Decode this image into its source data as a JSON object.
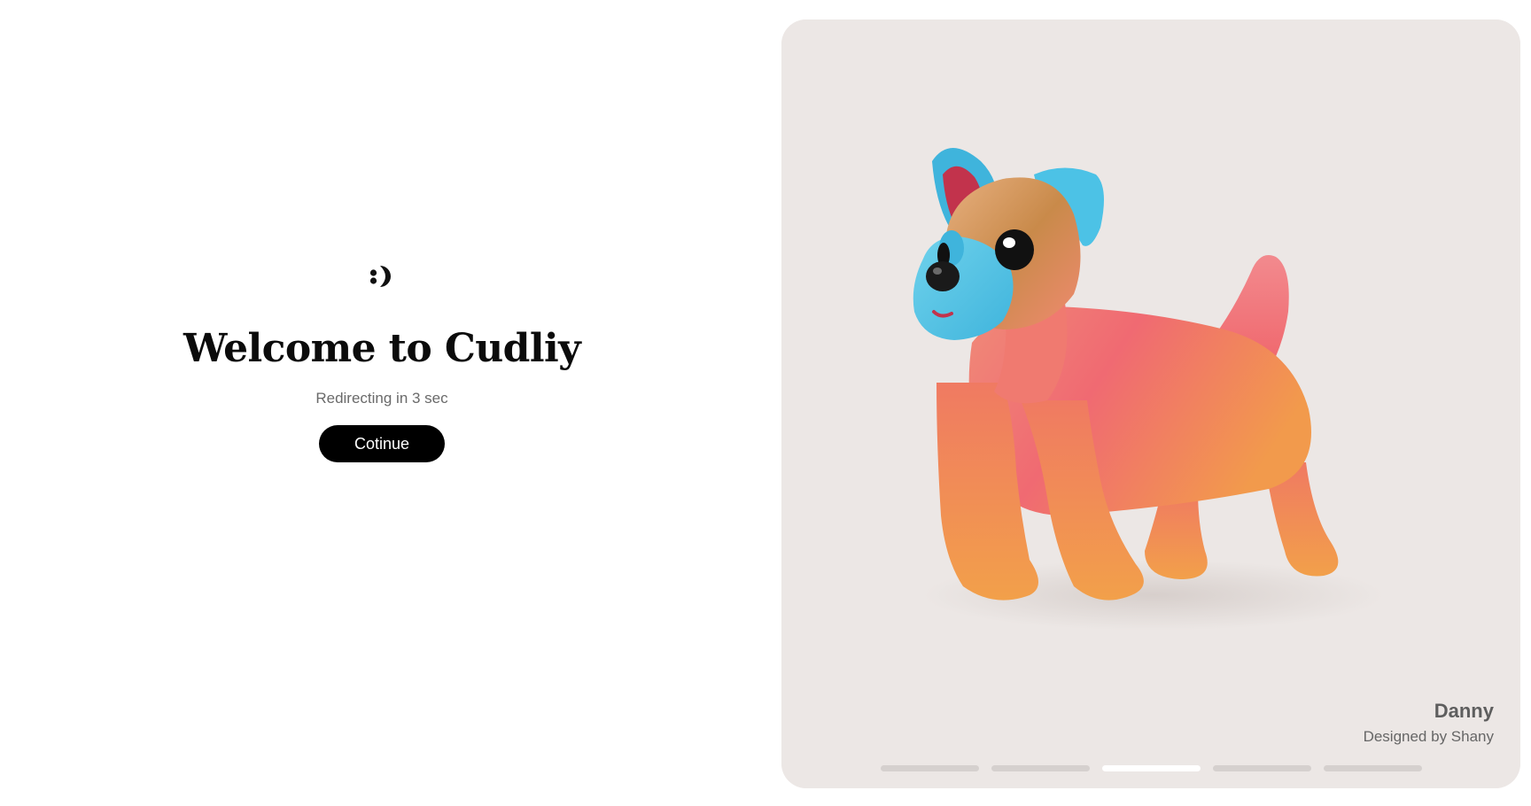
{
  "welcome": {
    "title": "Welcome to Cudliy",
    "redirect_text": "Redirecting in 3 sec",
    "continue_label": "Cotinue"
  },
  "logo": {
    "icon": "cudliy-logo-icon"
  },
  "showcase": {
    "image": "3d-toy-dog-image",
    "item_name": "Danny",
    "designer": "Designed by Shany",
    "background_color": "#ece7e5"
  },
  "pagination": {
    "total": 5,
    "active_index": 2
  },
  "colors": {
    "button_bg": "#000000",
    "dot_active": "#ffffff",
    "dot_inactive": "#d5d0ce"
  }
}
